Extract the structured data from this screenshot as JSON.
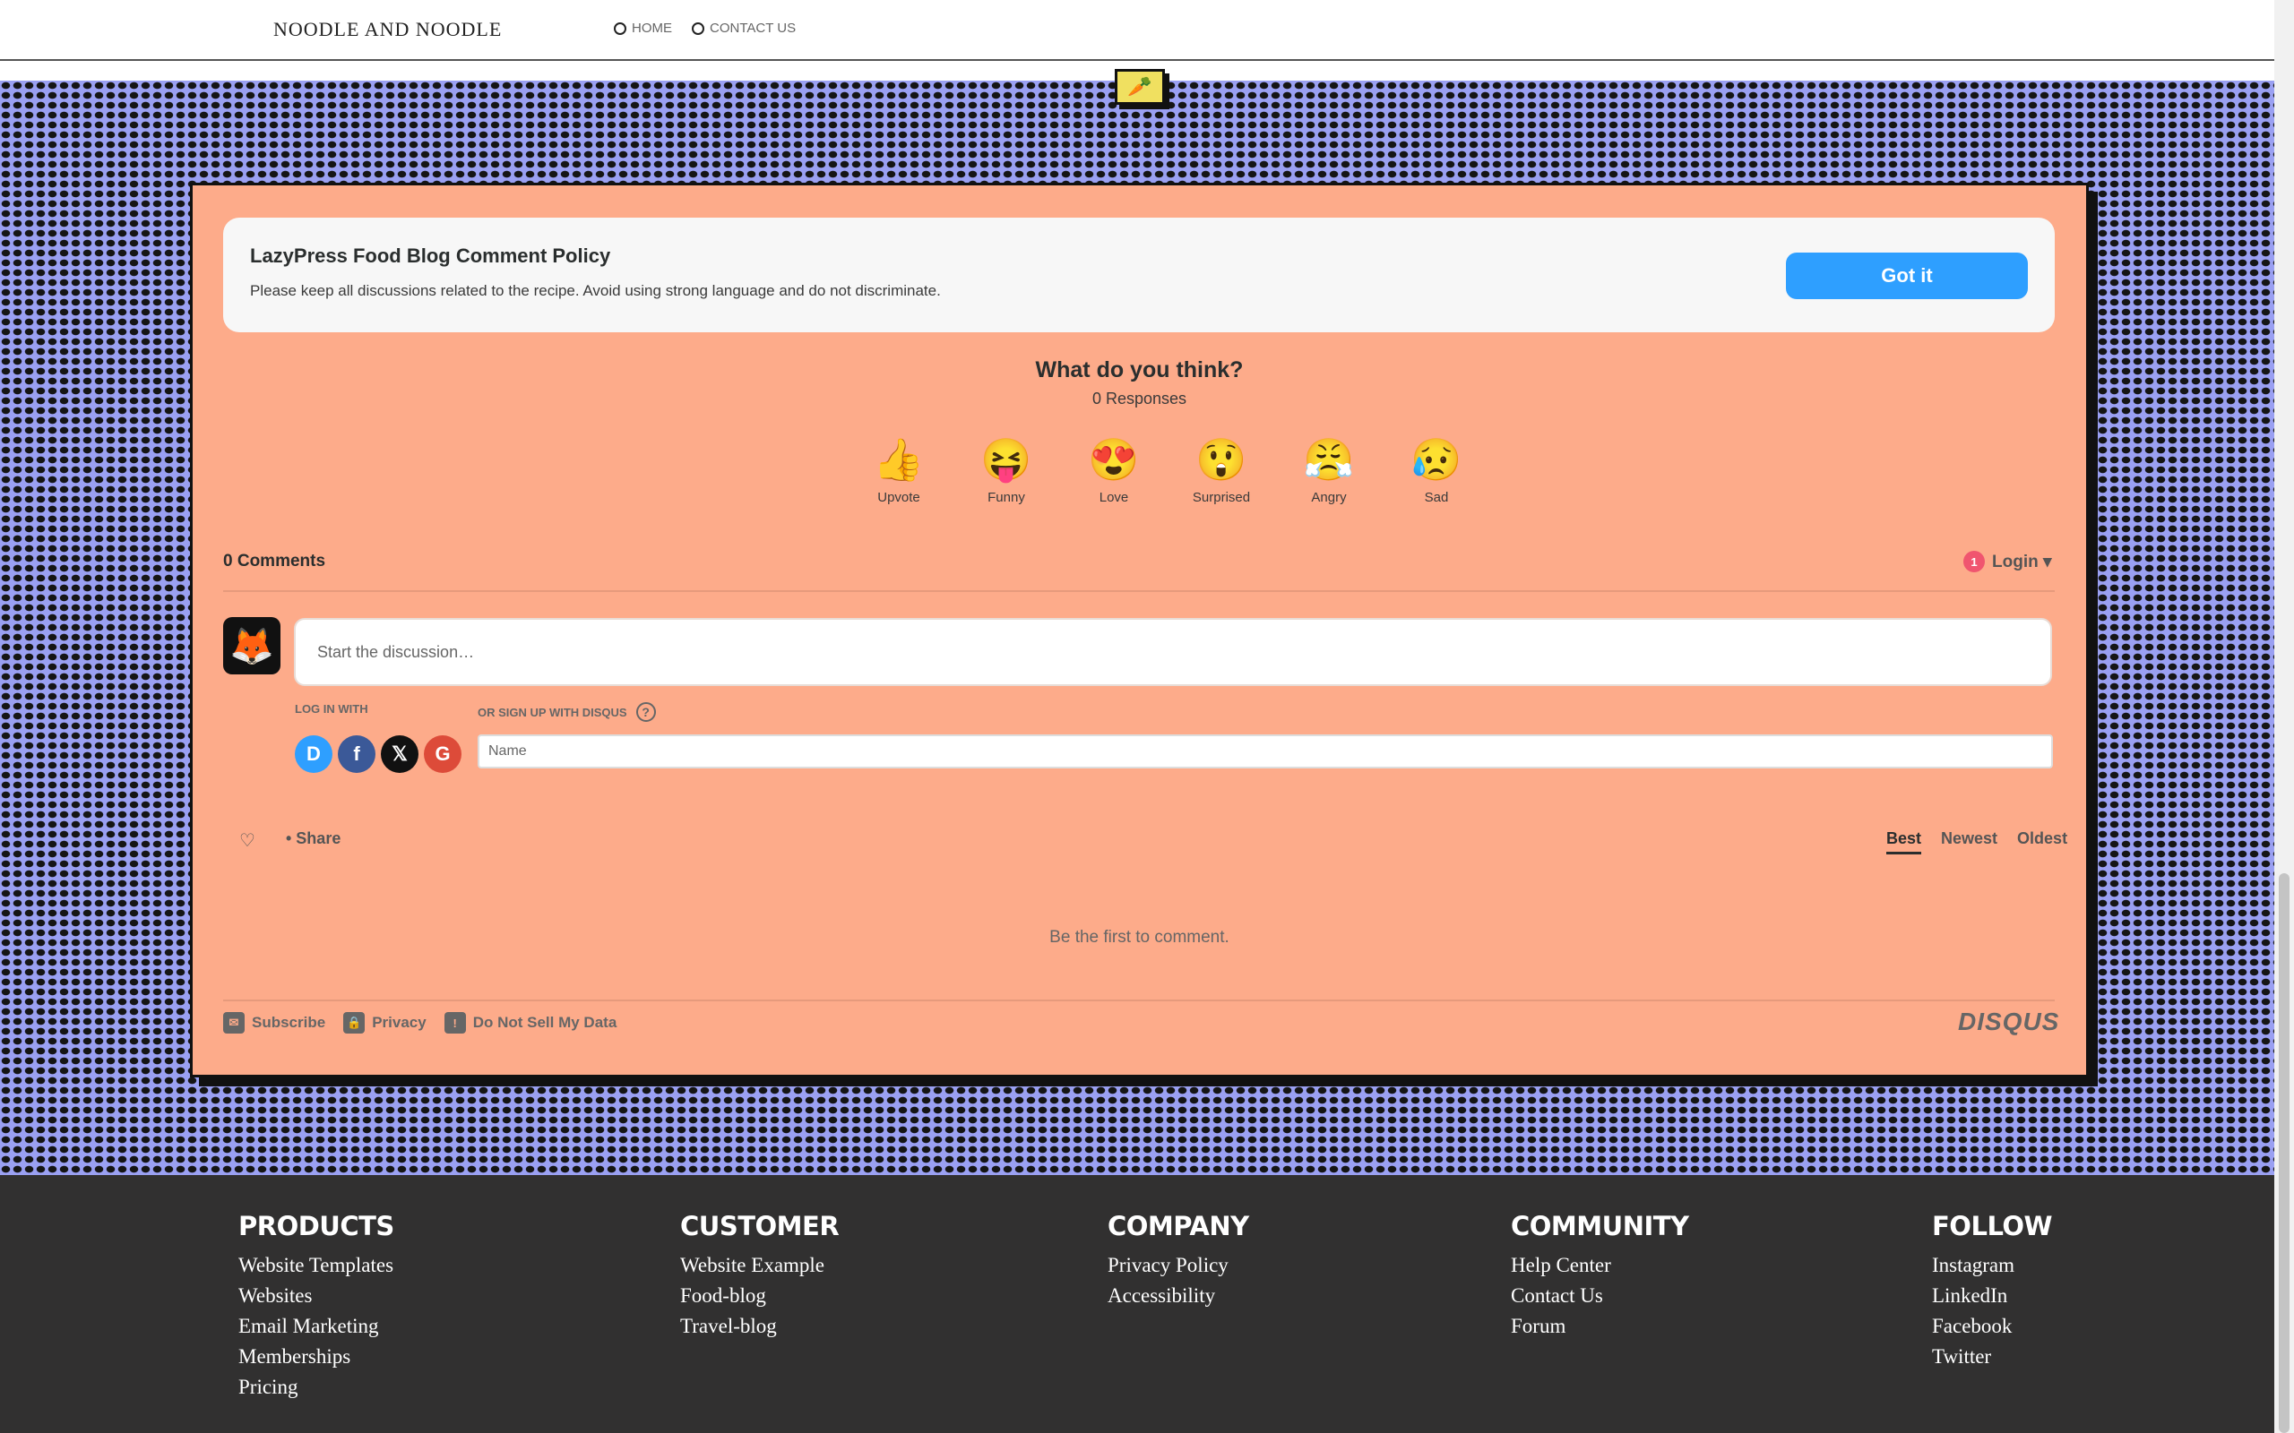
{
  "header": {
    "brand": "NOODLE AND NOODLE",
    "nav": [
      {
        "label": "HOME"
      },
      {
        "label": "CONTACT US"
      }
    ]
  },
  "badge_icon": "carrot-icon",
  "disqus": {
    "policy": {
      "title": "LazyPress Food Blog Comment Policy",
      "text": "Please keep all discussions related to the recipe. Avoid using strong language and do not discriminate.",
      "button": "Got it"
    },
    "question": "What do you think?",
    "responses": "0 Responses",
    "reactions": [
      {
        "label": "Upvote",
        "emoji": "👍"
      },
      {
        "label": "Funny",
        "emoji": "😝"
      },
      {
        "label": "Love",
        "emoji": "😍"
      },
      {
        "label": "Surprised",
        "emoji": "😲"
      },
      {
        "label": "Angry",
        "emoji": "😤"
      },
      {
        "label": "Sad",
        "emoji": "😥"
      }
    ],
    "comments_count": "0 Comments",
    "notification_count": "1",
    "login_label": "Login ▾",
    "start_placeholder": "Start the discussion…",
    "login_with": "LOG IN WITH",
    "signup_with": "OR SIGN UP WITH DISQUS",
    "help_symbol": "?",
    "socials": [
      {
        "name": "disqus",
        "glyph": "D",
        "color": "#2e9fff"
      },
      {
        "name": "facebook",
        "glyph": "f",
        "color": "#3b5998"
      },
      {
        "name": "x",
        "glyph": "𝕏",
        "color": "#111111"
      },
      {
        "name": "google",
        "glyph": "G",
        "color": "#dd4b39"
      }
    ],
    "name_placeholder": "Name",
    "share_label": "• Share",
    "sort": [
      "Best",
      "Newest",
      "Oldest"
    ],
    "active_sort": "Best",
    "empty_message": "Be the first to comment.",
    "footer_links": [
      {
        "label": "Subscribe",
        "icon": "mail-icon",
        "glyph": "✉"
      },
      {
        "label": "Privacy",
        "icon": "lock-icon",
        "glyph": "🔒"
      },
      {
        "label": "Do Not Sell My Data",
        "icon": "alert-icon",
        "glyph": "!"
      }
    ],
    "logo": "DISQUS"
  },
  "footer": {
    "columns": [
      {
        "title": "PRODUCTS",
        "items": [
          "Website Templates",
          "Websites",
          "Email Marketing",
          "Memberships",
          "Pricing"
        ]
      },
      {
        "title": "CUSTOMER",
        "items": [
          "Website Example",
          "Food-blog",
          "Travel-blog"
        ]
      },
      {
        "title": "COMPANY",
        "items": [
          "Privacy Policy",
          "Accessibility"
        ]
      },
      {
        "title": "COMMUNITY",
        "items": [
          "Help Center",
          "Contact Us",
          "Forum"
        ]
      },
      {
        "title": "FOLLOW",
        "items": [
          "Instagram",
          "LinkedIn",
          "Facebook",
          "Twitter"
        ]
      }
    ]
  },
  "colors": {
    "accent": "#2e9fff",
    "card_bg": "#fdab8a",
    "pattern_bg": "#9aa0f2",
    "footer_bg": "#313030"
  }
}
